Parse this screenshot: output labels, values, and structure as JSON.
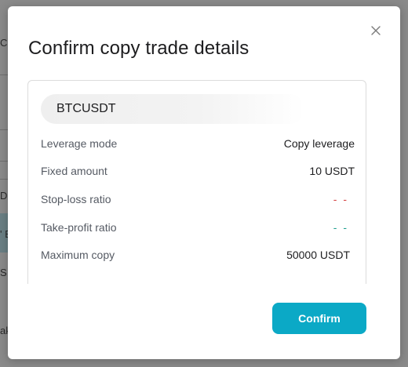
{
  "background": {
    "fragments": [
      "C",
      "D",
      "' B",
      "S",
      "ak"
    ]
  },
  "modal": {
    "title": "Confirm copy trade details",
    "close_icon": "close-icon",
    "pair": "BTCUSDT",
    "rows": [
      {
        "label": "Leverage mode",
        "value": "Copy leverage"
      },
      {
        "label": "Fixed amount",
        "value": "10 USDT"
      },
      {
        "label": "Stop-loss ratio",
        "value": "- -"
      },
      {
        "label": "Take-profit ratio",
        "value": "- -"
      },
      {
        "label": "Maximum copy",
        "value": "50000 USDT"
      }
    ],
    "confirm_label": "Confirm"
  },
  "colors": {
    "accent": "#0ba9c6",
    "loss": "#d64545",
    "profit": "#1f9e8f"
  }
}
